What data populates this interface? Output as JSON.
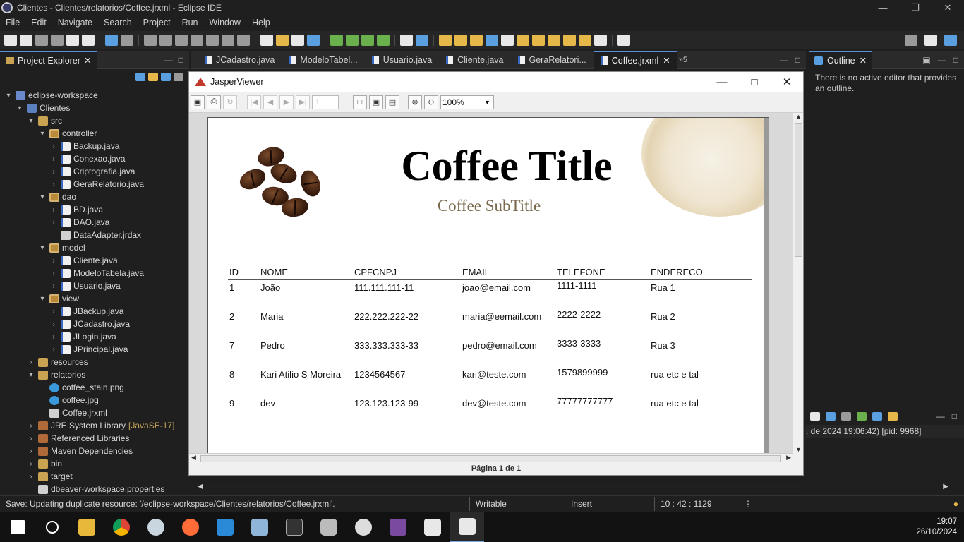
{
  "window": {
    "title": "Clientes - Clientes/relatorios/Coffee.jrxml - Eclipse IDE"
  },
  "menu": [
    "File",
    "Edit",
    "Navigate",
    "Search",
    "Project",
    "Run",
    "Window",
    "Help"
  ],
  "project_explorer": {
    "title": "Project Explorer",
    "tree": [
      {
        "label": "eclipse-workspace",
        "indent": 0,
        "arrow": "▾",
        "icon": "ws"
      },
      {
        "label": "Clientes",
        "indent": 1,
        "arrow": "▾",
        "icon": "proj"
      },
      {
        "label": "src",
        "indent": 2,
        "arrow": "▾",
        "icon": "folder"
      },
      {
        "label": "controller",
        "indent": 3,
        "arrow": "▾",
        "icon": "pkg"
      },
      {
        "label": "Backup.java",
        "indent": 4,
        "arrow": "›",
        "icon": "java"
      },
      {
        "label": "Conexao.java",
        "indent": 4,
        "arrow": "›",
        "icon": "java"
      },
      {
        "label": "Criptografia.java",
        "indent": 4,
        "arrow": "›",
        "icon": "java"
      },
      {
        "label": "GeraRelatorio.java",
        "indent": 4,
        "arrow": "›",
        "icon": "java"
      },
      {
        "label": "dao",
        "indent": 3,
        "arrow": "▾",
        "icon": "pkg"
      },
      {
        "label": "BD.java",
        "indent": 4,
        "arrow": "›",
        "icon": "java"
      },
      {
        "label": "DAO.java",
        "indent": 4,
        "arrow": "›",
        "icon": "java"
      },
      {
        "label": "DataAdapter.jrdax",
        "indent": 4,
        "arrow": "",
        "icon": "file"
      },
      {
        "label": "model",
        "indent": 3,
        "arrow": "▾",
        "icon": "pkg"
      },
      {
        "label": "Cliente.java",
        "indent": 4,
        "arrow": "›",
        "icon": "java"
      },
      {
        "label": "ModeloTabela.java",
        "indent": 4,
        "arrow": "›",
        "icon": "java"
      },
      {
        "label": "Usuario.java",
        "indent": 4,
        "arrow": "›",
        "icon": "java"
      },
      {
        "label": "view",
        "indent": 3,
        "arrow": "▾",
        "icon": "pkg"
      },
      {
        "label": "JBackup.java",
        "indent": 4,
        "arrow": "›",
        "icon": "java"
      },
      {
        "label": "JCadastro.java",
        "indent": 4,
        "arrow": "›",
        "icon": "java"
      },
      {
        "label": "JLogin.java",
        "indent": 4,
        "arrow": "›",
        "icon": "java"
      },
      {
        "label": "JPrincipal.java",
        "indent": 4,
        "arrow": "›",
        "icon": "java"
      },
      {
        "label": "resources",
        "indent": 2,
        "arrow": "›",
        "icon": "folder"
      },
      {
        "label": "relatorios",
        "indent": 2,
        "arrow": "▾",
        "icon": "folder"
      },
      {
        "label": "coffee_stain.png",
        "indent": 3,
        "arrow": "",
        "icon": "img"
      },
      {
        "label": "coffee.jpg",
        "indent": 3,
        "arrow": "",
        "icon": "img"
      },
      {
        "label": "Coffee.jrxml",
        "indent": 3,
        "arrow": "",
        "icon": "file"
      },
      {
        "label": "JRE System Library",
        "decoration": "[JavaSE-17]",
        "indent": 2,
        "arrow": "›",
        "icon": "lib"
      },
      {
        "label": "Referenced Libraries",
        "indent": 2,
        "arrow": "›",
        "icon": "lib"
      },
      {
        "label": "Maven Dependencies",
        "indent": 2,
        "arrow": "›",
        "icon": "lib"
      },
      {
        "label": "bin",
        "indent": 2,
        "arrow": "›",
        "icon": "folder"
      },
      {
        "label": "target",
        "indent": 2,
        "arrow": "›",
        "icon": "folder"
      },
      {
        "label": "dbeaver-workspace.properties",
        "indent": 2,
        "arrow": "",
        "icon": "file"
      }
    ]
  },
  "editor_tabs": [
    {
      "label": "JCadastro.java",
      "active": false
    },
    {
      "label": "ModeloTabel...",
      "active": false
    },
    {
      "label": "Usuario.java",
      "active": false
    },
    {
      "label": "Cliente.java",
      "active": false
    },
    {
      "label": "GeraRelatori...",
      "active": false
    },
    {
      "label": "Coffee.jrxml",
      "active": true
    }
  ],
  "editor_more": "»5",
  "outline": {
    "title": "Outline",
    "message": "There is no active editor that provides an outline."
  },
  "console": {
    "info": ". de 2024 19:06:42) [pid: 9968]"
  },
  "jasper": {
    "title": "JasperViewer",
    "page_input": "1",
    "zoom": "100%",
    "page_status": "Página 1 de 1",
    "report": {
      "title": "Coffee Title",
      "subtitle": "Coffee SubTitle",
      "columns": [
        "ID",
        "NOME",
        "CPFCNPJ",
        "EMAIL",
        "TELEFONE",
        "ENDERECO"
      ],
      "rows": [
        [
          "1",
          "João",
          "111.111.111-11",
          "joao@email.com",
          "1111-1111",
          "Rua 1"
        ],
        [
          "2",
          "Maria",
          "222.222.222-22",
          "maria@eemail.com",
          "2222-2222",
          "Rua 2"
        ],
        [
          "7",
          "Pedro",
          "333.333.333-33",
          "pedro@email.com",
          "3333-3333",
          "Rua 3"
        ],
        [
          "8",
          "Kari Atilio S Moreira",
          "1234564567",
          "kari@teste.com",
          "1579899999",
          "rua etc e tal"
        ],
        [
          "9",
          "dev",
          "123.123.123-99",
          "dev@teste.com",
          "77777777777",
          "rua etc e tal"
        ]
      ]
    }
  },
  "statusbar": {
    "message": "Save: Updating duplicate resource: '/eclipse-workspace/Clientes/relatorios/Coffee.jrxml'.",
    "writable": "Writable",
    "insert": "Insert",
    "position": "10 : 42 : 1129"
  },
  "taskbar": {
    "time": "19:07",
    "date": "26/10/2024"
  }
}
